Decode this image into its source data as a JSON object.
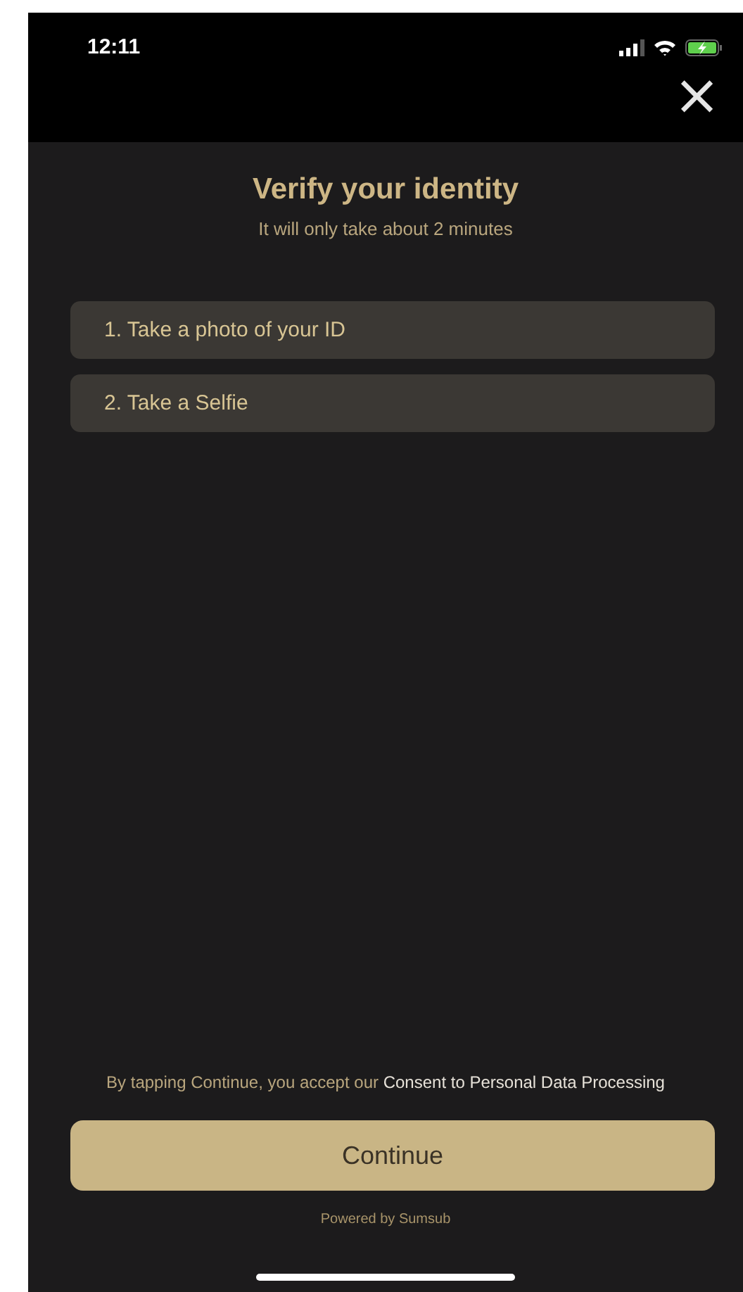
{
  "status_bar": {
    "time": "12:11"
  },
  "header": {
    "close": "×"
  },
  "title": "Verify your identity",
  "subtitle": "It will only take about 2 minutes",
  "steps": [
    {
      "label": "1. Take a photo of your ID"
    },
    {
      "label": "2. Take a Selfie"
    }
  ],
  "consent": {
    "text": "By tapping Continue, you accept our",
    "link": "Consent to Personal Data Processing"
  },
  "button": "Continue",
  "footer": "Powered by Sumsub"
}
